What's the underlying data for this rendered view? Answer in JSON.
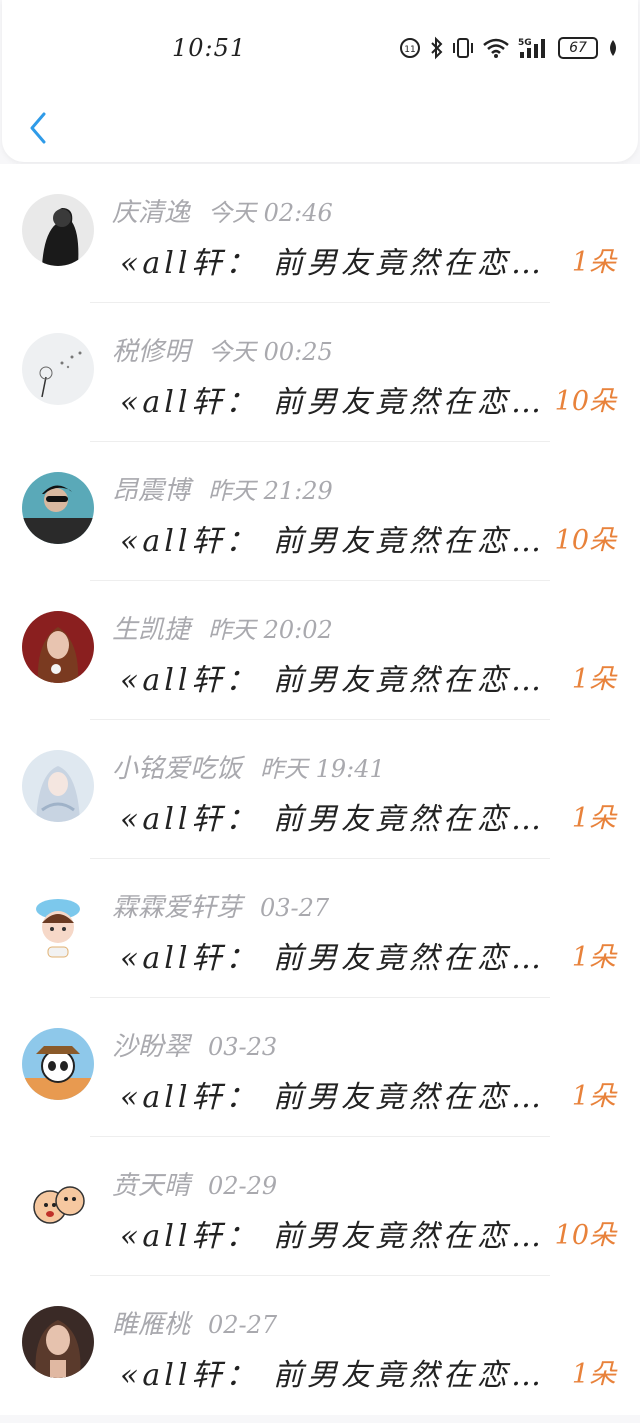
{
  "status_bar": {
    "time": "10:51",
    "battery": "67"
  },
  "header": {
    "back_icon": "chevron-left-icon"
  },
  "messages": [
    {
      "name": "庆清逸",
      "time": "今天 02:46",
      "text": "«all轩： 前男友竟然在恋…",
      "count": "1朵"
    },
    {
      "name": "税修明",
      "time": "今天 00:25",
      "text": "«all轩： 前男友竟然在恋…",
      "count": "10朵"
    },
    {
      "name": "昂震博",
      "time": "昨天 21:29",
      "text": "«all轩： 前男友竟然在恋…",
      "count": "10朵"
    },
    {
      "name": "生凯捷",
      "time": "昨天 20:02",
      "text": "«all轩： 前男友竟然在恋…",
      "count": "1朵"
    },
    {
      "name": "小铭爱吃饭",
      "time": "昨天 19:41",
      "text": "«all轩： 前男友竟然在恋…",
      "count": "1朵"
    },
    {
      "name": "霖霖爱轩芽",
      "time": "03-27",
      "text": "«all轩： 前男友竟然在恋…",
      "count": "1朵"
    },
    {
      "name": "沙盼翠",
      "time": "03-23",
      "text": "«all轩： 前男友竟然在恋…",
      "count": "1朵"
    },
    {
      "name": "贲天晴",
      "time": "02-29",
      "text": "«all轩： 前男友竟然在恋…",
      "count": "10朵"
    },
    {
      "name": "睢雁桃",
      "time": "02-27",
      "text": "«all轩： 前男友竟然在恋…",
      "count": "1朵"
    }
  ],
  "colors": {
    "accent": "#2f9be8",
    "count": "#e8823b",
    "meta": "#a9a9ae"
  }
}
